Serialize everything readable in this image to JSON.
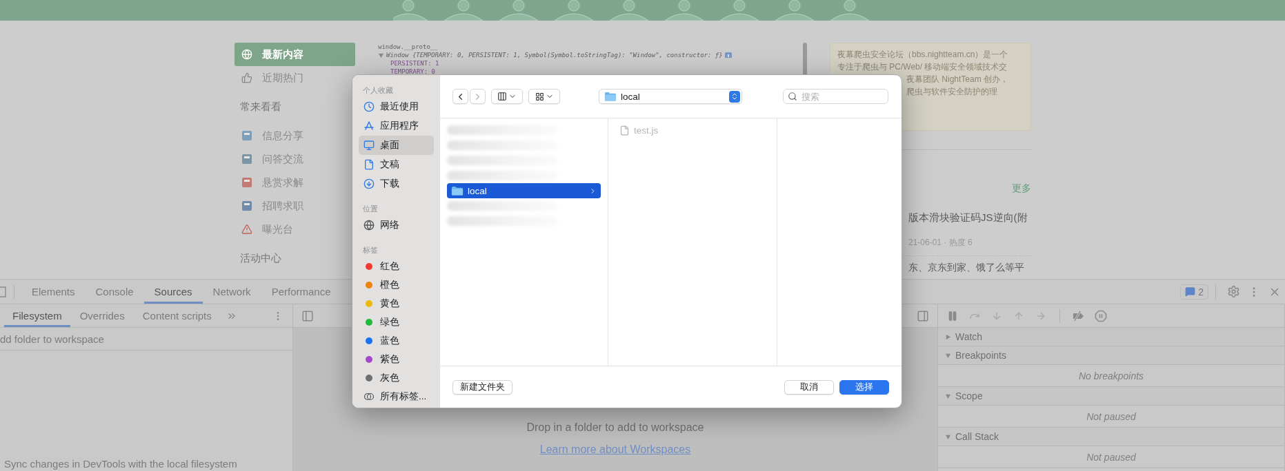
{
  "page": {
    "nav": [
      {
        "kind": "item",
        "label": "最新内容",
        "selected": true
      },
      {
        "kind": "item",
        "label": "近期热门",
        "selected": false
      },
      {
        "kind": "heading",
        "label": "常来看看"
      },
      {
        "kind": "item",
        "label": "信息分享",
        "selected": false
      },
      {
        "kind": "item",
        "label": "问答交流",
        "selected": false
      },
      {
        "kind": "item",
        "label": "悬赏求解",
        "selected": false
      },
      {
        "kind": "item",
        "label": "招聘求职",
        "selected": false
      },
      {
        "kind": "item",
        "label": "曝光台",
        "selected": false
      },
      {
        "kind": "heading",
        "label": "活动中心"
      }
    ],
    "code_lines": [
      {
        "kind": "expression",
        "text": "window.__proto__"
      },
      {
        "kind": "object",
        "text": "Window {TEMPORARY: 0, PERSISTENT: 1, Symbol(Symbol.toStringTag): \"Window\", constructor: ƒ}"
      },
      {
        "kind": "property",
        "text": "PERSISTENT: 1"
      },
      {
        "kind": "property",
        "text": "TEMPORARY: 0"
      }
    ],
    "intro_lines": [
      {
        "text": "夜幕爬虫安全论坛（bbs.nightteam.cn）是一个",
        "partly_hidden": false
      },
      {
        "text": "专注于爬虫与 PC/Web/ 移动端安全领域技术交",
        "partly_hidden": false
      },
      {
        "text": "夜幕团队 NightTeam 创办，",
        "partly_hidden": true
      },
      {
        "text": "爬虫与软件安全防护的理",
        "partly_hidden": true
      }
    ],
    "more_link": "更多",
    "article": {
      "title": "版本滑块验证码JS逆向(附",
      "meta": "21-06-01 · 热度 6",
      "next_title": "东、京东到家、饿了么等平"
    }
  },
  "devtools": {
    "tabs": [
      {
        "label": "Elements",
        "selected": false
      },
      {
        "label": "Console",
        "selected": false
      },
      {
        "label": "Sources",
        "selected": true
      },
      {
        "label": "Network",
        "selected": false
      },
      {
        "label": "Performance",
        "selected": false
      }
    ],
    "issues_count": "2",
    "sub_tabs": [
      {
        "label": "Filesystem",
        "selected": true
      },
      {
        "label": "Overrides",
        "selected": false
      },
      {
        "label": "Content scripts",
        "selected": false
      }
    ],
    "add_folder": "dd folder to workspace",
    "sync_hint": "Sync changes in DevTools with the local filesystem",
    "drop_text": "Drop in a folder to add to workspace",
    "learn_link": "Learn more about Workspaces",
    "sections": [
      {
        "title": "Watch",
        "expanded": false
      },
      {
        "title": "Breakpoints",
        "expanded": true,
        "message": "No breakpoints"
      },
      {
        "title": "Scope",
        "expanded": true,
        "message": "Not paused"
      },
      {
        "title": "Call Stack",
        "expanded": true,
        "message": "Not paused"
      }
    ]
  },
  "dialog": {
    "sidebar": [
      {
        "kind": "heading",
        "label": "个人收藏"
      },
      {
        "kind": "place",
        "label": "最近使用",
        "selected": false
      },
      {
        "kind": "place",
        "label": "应用程序",
        "selected": false
      },
      {
        "kind": "place",
        "label": "桌面",
        "selected": true
      },
      {
        "kind": "place",
        "label": "文稿",
        "selected": false
      },
      {
        "kind": "place",
        "label": "下载",
        "selected": false
      },
      {
        "kind": "heading",
        "label": "位置"
      },
      {
        "kind": "place",
        "label": "网络",
        "selected": false
      },
      {
        "kind": "heading",
        "label": "标签"
      },
      {
        "kind": "tag",
        "label": "红色",
        "color": "#f03a2f",
        "selected": false
      },
      {
        "kind": "tag",
        "label": "橙色",
        "color": "#f0830f",
        "selected": false
      },
      {
        "kind": "tag",
        "label": "黄色",
        "color": "#eeb90f",
        "selected": false
      },
      {
        "kind": "tag",
        "label": "绿色",
        "color": "#1fba3a",
        "selected": false
      },
      {
        "kind": "tag",
        "label": "蓝色",
        "color": "#1a73f0",
        "selected": false
      },
      {
        "kind": "tag",
        "label": "紫色",
        "color": "#a448c9",
        "selected": false
      },
      {
        "kind": "tag",
        "label": "灰色",
        "color": "#6e6e73",
        "selected": false
      },
      {
        "kind": "all_tags",
        "label": "所有标签...",
        "selected": false
      }
    ],
    "location": "local",
    "search_placeholder": "搜索",
    "columns": [
      [
        {
          "kind": "blurred"
        },
        {
          "kind": "blurred"
        },
        {
          "kind": "blurred"
        },
        {
          "kind": "blurred"
        },
        {
          "kind": "folder",
          "name": "local",
          "selected": true
        },
        {
          "kind": "blurred"
        },
        {
          "kind": "blurred"
        }
      ],
      [
        {
          "kind": "file",
          "name": "test.js",
          "selected": false,
          "disabled": true
        }
      ],
      []
    ],
    "buttons": [
      {
        "kind": "secondary",
        "label": "新建文件夹"
      },
      {
        "kind": "spacer"
      },
      {
        "kind": "secondary",
        "label": "取消"
      },
      {
        "kind": "primary",
        "label": "选择"
      }
    ]
  }
}
